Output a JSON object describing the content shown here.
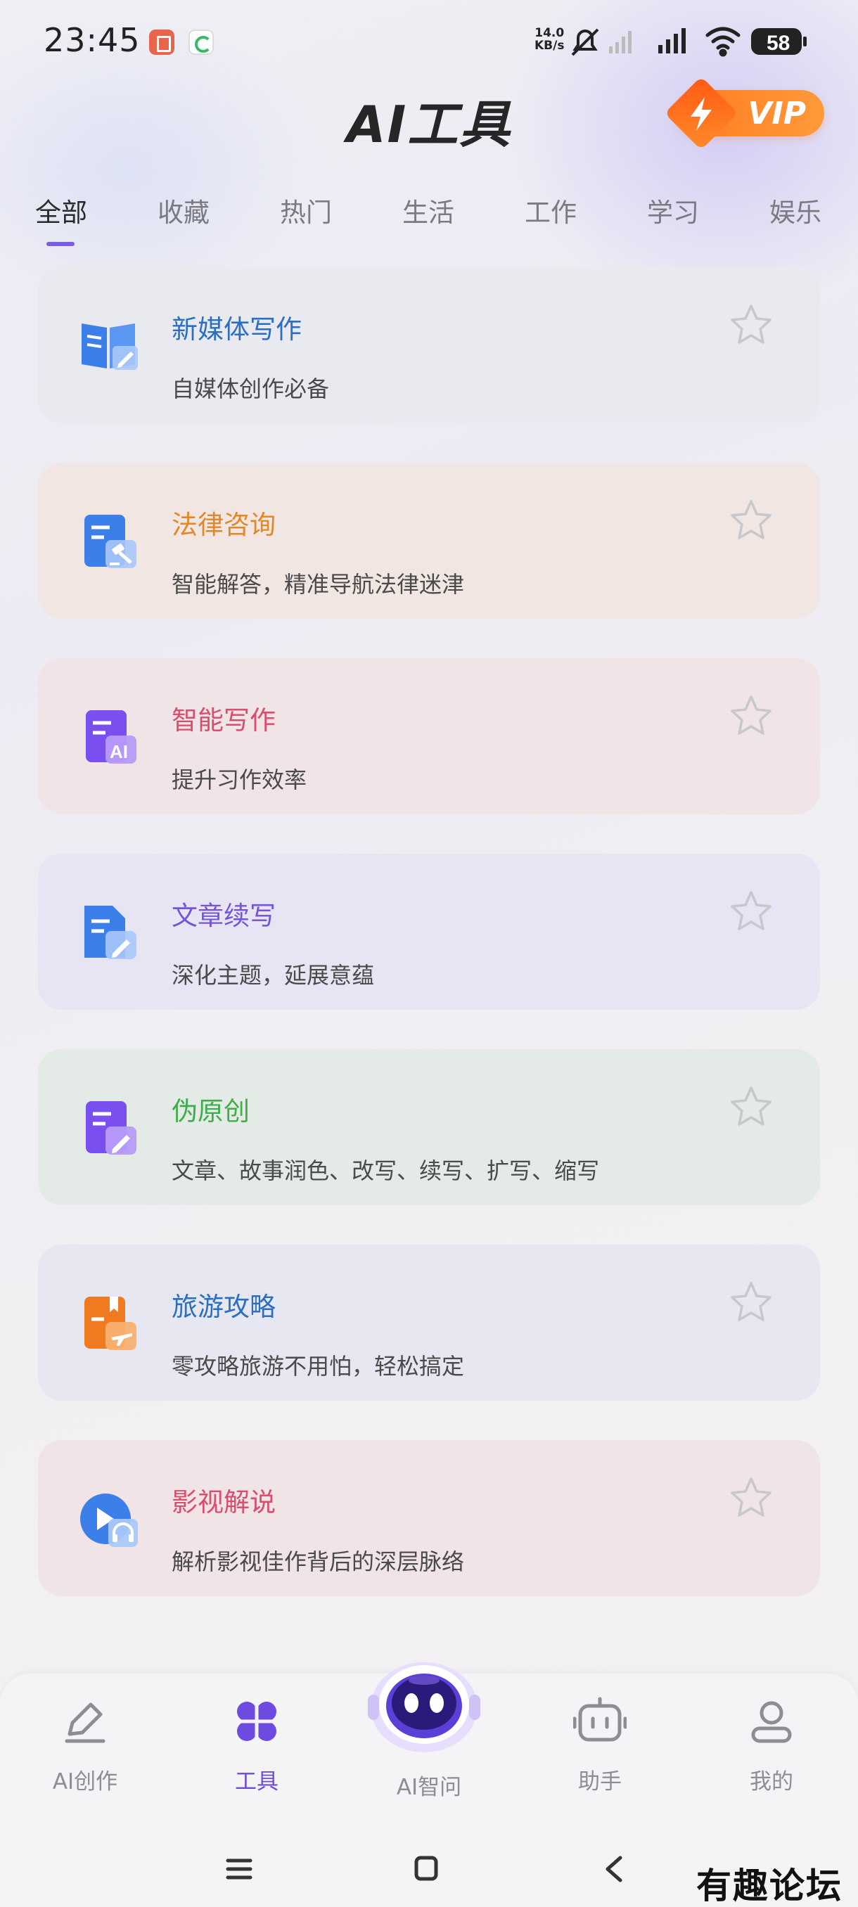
{
  "status_bar": {
    "time": "23:45",
    "net_speed_value": "14.0",
    "net_speed_unit": "KB/s",
    "battery": "58"
  },
  "header": {
    "title": "AI工具",
    "vip_label": "VIP"
  },
  "tabs": [
    {
      "label": "全部",
      "active": true
    },
    {
      "label": "收藏"
    },
    {
      "label": "热门"
    },
    {
      "label": "生活"
    },
    {
      "label": "工作"
    },
    {
      "label": "学习"
    },
    {
      "label": "娱乐"
    }
  ],
  "cards": [
    {
      "title": "新媒体写作",
      "desc": "自媒体创作必备",
      "title_color": "#2b6fc2",
      "bg": "#e9eaf0",
      "icon": "book-edit-icon"
    },
    {
      "title": "法律咨询",
      "desc": "智能解答，精准导航法律迷津",
      "title_color": "#e0882a",
      "bg": "#f1e6e2",
      "icon": "law-document-icon"
    },
    {
      "title": "智能写作",
      "desc": "提升习作效率",
      "title_color": "#d84e6d",
      "bg": "#f1e4e6",
      "icon": "ai-document-icon"
    },
    {
      "title": "文章续写",
      "desc": "深化主题，延展意蕴",
      "title_color": "#7554d6",
      "bg": "#e7e4f3",
      "icon": "document-edit-icon"
    },
    {
      "title": "伪原创",
      "desc": "文章、故事润色、改写、续写、扩写、缩写",
      "title_color": "#3fae4a",
      "bg": "#e4ebe6",
      "icon": "purple-document-edit-icon"
    },
    {
      "title": "旅游攻略",
      "desc": "零攻略旅游不用怕，轻松搞定",
      "title_color": "#2b6fc2",
      "bg": "#e6e7f1",
      "icon": "travel-book-icon"
    },
    {
      "title": "影视解说",
      "desc": "解析影视佳作背后的深层脉络",
      "title_color": "#d84e6d",
      "bg": "#f1e4e6",
      "icon": "video-headphones-icon"
    }
  ],
  "bottom_nav": [
    {
      "label": "AI创作",
      "icon": "pen-icon"
    },
    {
      "label": "工具",
      "icon": "four-petal-icon",
      "active": true
    },
    {
      "label": "AI智问",
      "icon": "robot-avatar-icon"
    },
    {
      "label": "助手",
      "icon": "assistant-robot-icon"
    },
    {
      "label": "我的",
      "icon": "user-icon"
    }
  ],
  "watermark": "有趣论坛",
  "colors": {
    "accent": "#6e4be0",
    "vip": "#ff7a1f"
  }
}
